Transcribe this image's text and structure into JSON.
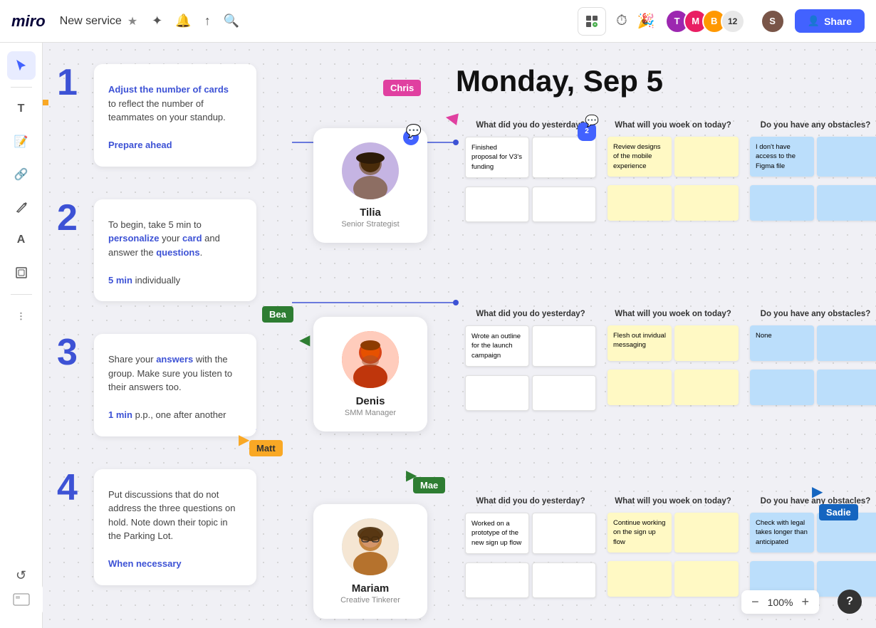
{
  "topbar": {
    "logo": "miro",
    "project_name": "New service",
    "share_label": "Share",
    "zoom_level": "100%",
    "collab_count": "12"
  },
  "date_title": "Monday, Sep 5",
  "cursors": {
    "chris": {
      "label": "Chris",
      "color": "#e040a0"
    },
    "bea": {
      "label": "Bea",
      "color": "#2e7d32"
    },
    "matt": {
      "label": "Matt",
      "color": "#f9a825"
    },
    "mae": {
      "label": "Mae",
      "color": "#2e7d32"
    },
    "sadie": {
      "label": "Sadie",
      "color": "#1565c0"
    }
  },
  "instructions": [
    {
      "step": "1",
      "text_html": "Adjust the number of cards to reflect the number of teammates on your standup.",
      "subtext": "Prepare ahead"
    },
    {
      "step": "2",
      "text_html": "To begin, take 5 min to personalize your card and answer the questions.",
      "subtext": "5 min individually"
    },
    {
      "step": "3",
      "text_html": "Share your answers with the group. Make sure you listen to their answers too.",
      "subtext": "1 min p.p., one after another"
    },
    {
      "step": "4",
      "text_html": "Put discussions that do not address the three questions on hold. Note down their topic in the Parking Lot.",
      "subtext": "When necessary"
    }
  ],
  "people": [
    {
      "name": "Tilia",
      "role": "Senior Strategist",
      "chat_count": 3,
      "color": "#b39ddb"
    },
    {
      "name": "Denis",
      "role": "SMM Manager",
      "chat_count": 0,
      "color": "#ff8a65"
    },
    {
      "name": "Mariam",
      "role": "Creative Tinkerer",
      "chat_count": 0,
      "color": "#aed6f1"
    }
  ],
  "standup_columns": [
    "What did you do yesterday?",
    "What will you woek on today?",
    "Do you have any obstacles?"
  ],
  "row1_stickies": {
    "yesterday": [
      {
        "type": "white",
        "text": "Finished proposal for V3's funding"
      },
      {
        "type": "white",
        "text": ""
      }
    ],
    "today": [
      {
        "type": "yellow",
        "text": "Review designs of the mobile experience"
      },
      {
        "type": "yellow",
        "text": ""
      }
    ],
    "obstacles": [
      {
        "type": "blue",
        "text": "I don't have access to the Figma file"
      },
      {
        "type": "blue",
        "text": ""
      }
    ]
  },
  "row2_stickies": {
    "yesterday": [
      {
        "type": "white",
        "text": "Wrote an outline for the launch campaign"
      },
      {
        "type": "white",
        "text": ""
      }
    ],
    "today": [
      {
        "type": "yellow",
        "text": "Flesh out invidual messaging"
      },
      {
        "type": "yellow",
        "text": ""
      }
    ],
    "obstacles": [
      {
        "type": "blue",
        "text": "None"
      },
      {
        "type": "blue",
        "text": ""
      }
    ]
  },
  "row3_stickies": {
    "yesterday": [
      {
        "type": "white",
        "text": "Worked on a prototype of the new sign up flow"
      },
      {
        "type": "white",
        "text": ""
      }
    ],
    "today": [
      {
        "type": "yellow",
        "text": "Continue working on the sign up flow"
      },
      {
        "type": "yellow",
        "text": ""
      }
    ],
    "obstacles": [
      {
        "type": "blue",
        "text": "Check with legal takes longer than anticipated"
      },
      {
        "type": "blue",
        "text": ""
      }
    ]
  }
}
